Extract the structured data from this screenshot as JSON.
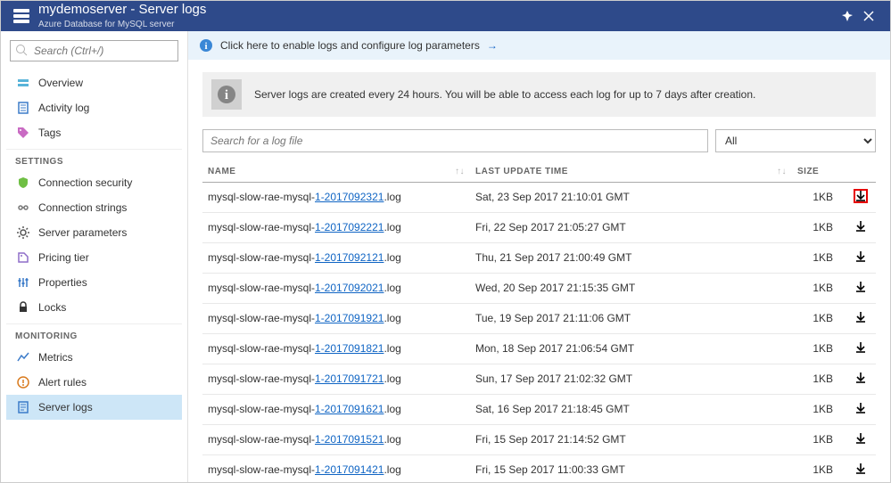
{
  "header": {
    "title": "mydemoserver - Server logs",
    "subtitle": "Azure Database for MySQL server"
  },
  "search": {
    "placeholder": "Search (Ctrl+/)"
  },
  "sidebar": {
    "top": [
      {
        "label": "Overview",
        "icon": "overview"
      },
      {
        "label": "Activity log",
        "icon": "activitylog"
      },
      {
        "label": "Tags",
        "icon": "tags"
      }
    ],
    "groups": [
      {
        "title": "SETTINGS",
        "items": [
          {
            "label": "Connection security",
            "icon": "shield"
          },
          {
            "label": "Connection strings",
            "icon": "connstr"
          },
          {
            "label": "Server parameters",
            "icon": "gear"
          },
          {
            "label": "Pricing tier",
            "icon": "pricing"
          },
          {
            "label": "Properties",
            "icon": "props"
          },
          {
            "label": "Locks",
            "icon": "lock"
          }
        ]
      },
      {
        "title": "MONITORING",
        "items": [
          {
            "label": "Metrics",
            "icon": "metrics"
          },
          {
            "label": "Alert rules",
            "icon": "alert"
          },
          {
            "label": "Server logs",
            "icon": "logs",
            "active": true
          }
        ]
      }
    ]
  },
  "notice": {
    "text": "Click here to enable logs and configure log parameters"
  },
  "info_banner": "Server logs are created every 24 hours. You will be able to access each log for up to 7 days after creation.",
  "filters": {
    "search_placeholder": "Search for a log file",
    "dropdown_value": "All"
  },
  "table": {
    "columns": {
      "name": "NAME",
      "last_update": "LAST UPDATE TIME",
      "size": "SIZE"
    },
    "rows": [
      {
        "prefix": "mysql-slow-rae-mysql-",
        "link": "1-2017092321",
        "suffix": ".log",
        "last_update": "Sat, 23 Sep 2017 21:10:01 GMT",
        "size": "1KB",
        "highlight": true
      },
      {
        "prefix": "mysql-slow-rae-mysql-",
        "link": "1-2017092221",
        "suffix": ".log",
        "last_update": "Fri, 22 Sep 2017 21:05:27 GMT",
        "size": "1KB"
      },
      {
        "prefix": "mysql-slow-rae-mysql-",
        "link": "1-2017092121",
        "suffix": ".log",
        "last_update": "Thu, 21 Sep 2017 21:00:49 GMT",
        "size": "1KB"
      },
      {
        "prefix": "mysql-slow-rae-mysql-",
        "link": "1-2017092021",
        "suffix": ".log",
        "last_update": "Wed, 20 Sep 2017 21:15:35 GMT",
        "size": "1KB"
      },
      {
        "prefix": "mysql-slow-rae-mysql-",
        "link": "1-2017091921",
        "suffix": ".log",
        "last_update": "Tue, 19 Sep 2017 21:11:06 GMT",
        "size": "1KB"
      },
      {
        "prefix": "mysql-slow-rae-mysql-",
        "link": "1-2017091821",
        "suffix": ".log",
        "last_update": "Mon, 18 Sep 2017 21:06:54 GMT",
        "size": "1KB"
      },
      {
        "prefix": "mysql-slow-rae-mysql-",
        "link": "1-2017091721",
        "suffix": ".log",
        "last_update": "Sun, 17 Sep 2017 21:02:32 GMT",
        "size": "1KB"
      },
      {
        "prefix": "mysql-slow-rae-mysql-",
        "link": "1-2017091621",
        "suffix": ".log",
        "last_update": "Sat, 16 Sep 2017 21:18:45 GMT",
        "size": "1KB"
      },
      {
        "prefix": "mysql-slow-rae-mysql-",
        "link": "1-2017091521",
        "suffix": ".log",
        "last_update": "Fri, 15 Sep 2017 21:14:52 GMT",
        "size": "1KB"
      },
      {
        "prefix": "mysql-slow-rae-mysql-",
        "link": "1-2017091421",
        "suffix": ".log",
        "last_update": "Fri, 15 Sep 2017 11:00:33 GMT",
        "size": "1KB"
      }
    ]
  }
}
